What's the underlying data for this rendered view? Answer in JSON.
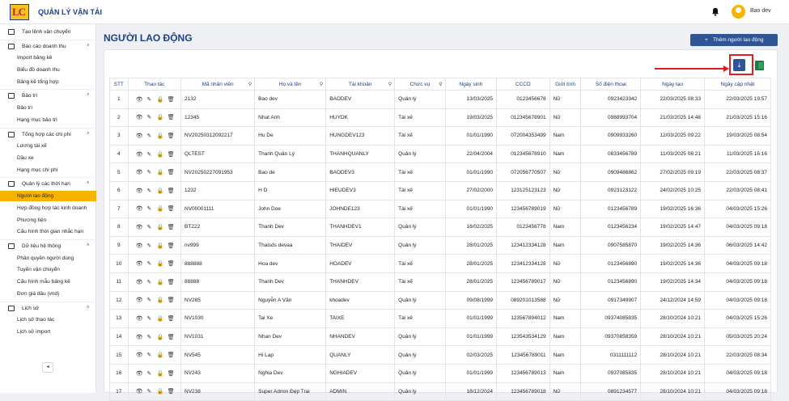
{
  "app": {
    "name": "QUẢN LÝ VẬN TẢI",
    "logo_text": "LC",
    "user": "Bao dev"
  },
  "sidebar": {
    "items": [
      {
        "type": "group",
        "label": "Tạo lệnh vận chuyển",
        "icon": "truck-icon",
        "chev": ""
      },
      {
        "type": "group",
        "label": "Báo cáo doanh thu",
        "icon": "report-icon",
        "chev": "˄"
      },
      {
        "type": "sub",
        "label": "Import bảng kê"
      },
      {
        "type": "sub",
        "label": "Biểu đồ doanh thu"
      },
      {
        "type": "sub",
        "label": "Bảng kê tổng hợp"
      },
      {
        "type": "group",
        "label": "Bảo trì",
        "icon": "wrench-icon",
        "chev": "˄"
      },
      {
        "type": "sub",
        "label": "Bảo trì"
      },
      {
        "type": "sub",
        "label": "Hạng mục bảo trì"
      },
      {
        "type": "group",
        "label": "Tổng hợp các chi phí",
        "icon": "cost-icon",
        "chev": "˄"
      },
      {
        "type": "sub",
        "label": "Lương tài xế"
      },
      {
        "type": "sub",
        "label": "Dầu xe"
      },
      {
        "type": "sub",
        "label": "Hạng mục chi phí"
      },
      {
        "type": "group",
        "label": "Quản lý các thời hạn",
        "icon": "clock-icon",
        "chev": "˄"
      },
      {
        "type": "sub",
        "label": "Người lao động",
        "active": true
      },
      {
        "type": "sub",
        "label": "Hợp đồng hợp tác kinh doanh"
      },
      {
        "type": "sub",
        "label": "Phương tiện"
      },
      {
        "type": "sub",
        "label": "Cấu hình thời gian nhắc hạn"
      },
      {
        "type": "group",
        "label": "Dữ liệu hệ thống",
        "icon": "database-icon",
        "chev": "˄"
      },
      {
        "type": "sub",
        "label": "Phân quyền người dùng"
      },
      {
        "type": "sub",
        "label": "Tuyến vận chuyển"
      },
      {
        "type": "sub",
        "label": "Cấu hình mẫu bảng kê"
      },
      {
        "type": "sub",
        "label": "Đơn giá dầu (vnd)"
      },
      {
        "type": "group",
        "label": "Lịch sử",
        "icon": "history-icon",
        "chev": "˄"
      },
      {
        "type": "sub",
        "label": "Lịch sử thao tác"
      },
      {
        "type": "sub",
        "label": "Lịch sử import"
      }
    ],
    "collapse_glyph": "◂"
  },
  "page": {
    "title": "NGƯỜI LAO ĐỘNG",
    "add_button": "Thêm người lao động",
    "add_glyph": "+",
    "download_glyph": "⤓"
  },
  "table": {
    "columns": [
      "STT",
      "Thao tác",
      "Mã nhân viên",
      "Họ và tên",
      "Tài khoản",
      "Chức vụ",
      "Ngày sinh",
      "CCCD",
      "Giới tính",
      "Số điện thoại",
      "Ngày tạo",
      "Ngày cập nhật"
    ],
    "searchable": [
      false,
      false,
      true,
      true,
      true,
      true,
      false,
      false,
      false,
      false,
      false,
      false
    ],
    "action_glyphs": [
      "👁",
      "✎",
      "🔒",
      "🗑"
    ],
    "rows": [
      [
        "1",
        "",
        "2132",
        "Bao dev",
        "BAODEV",
        "Quản lý",
        "13/03/2025",
        "0123456678",
        "Nữ",
        "0923423342",
        "22/03/2025 08:33",
        "22/03/2025 19:57"
      ],
      [
        "2",
        "",
        "12345",
        "Nhat Anh",
        "HUYDK",
        "Tài xế",
        "19/03/2025",
        "012345678901",
        "Nữ",
        "0988993704",
        "21/03/2025 14:48",
        "21/03/2025 15:16"
      ],
      [
        "3",
        "",
        "NV20250312092217",
        "Hu De",
        "HUNGDEV123",
        "Tài xế",
        "01/01/1990",
        "072004353499",
        "Nam",
        "0909933260",
        "12/03/2025 09:22",
        "19/03/2025 08:54"
      ],
      [
        "4",
        "",
        "QLTEST",
        "Thanh Quản Lý",
        "THANHQUANLY",
        "Quản lý",
        "22/04/2004",
        "012345678910",
        "Nam",
        "0833456789",
        "11/03/2025 08:21",
        "11/03/2025 16:16"
      ],
      [
        "5",
        "",
        "NV20250227091953",
        "Bao de",
        "BAODEV3",
        "Tài xế",
        "01/01/1990",
        "072056770507",
        "Nữ",
        "0909486862",
        "27/02/2025 09:19",
        "22/03/2025 08:37"
      ],
      [
        "6",
        "",
        "1232",
        "H D",
        "HIEUDEV3",
        "Tài xế",
        "27/02/2000",
        "123125123123",
        "Nữ",
        "0923123122",
        "24/02/2025 10:25",
        "22/03/2025 08:41"
      ],
      [
        "7",
        "",
        "NV00001111",
        "John Doe",
        "JOHNDE123",
        "Tài xế",
        "01/01/1990",
        "123456789019",
        "Nữ",
        "0123456789",
        "19/02/2025 16:36",
        "04/03/2025 15:26"
      ],
      [
        "8",
        "",
        "BT222",
        "Thanh Dev",
        "THANHDEV1",
        "Quản lý",
        "18/02/2025",
        "0123456778",
        "Nam",
        "0123456234",
        "19/02/2025 14:47",
        "04/03/2025 09:18"
      ],
      [
        "9",
        "",
        "nv999",
        "Thaisds devaa",
        "THAIDEV",
        "Quản lý",
        "28/01/2025",
        "123412334128",
        "Nam",
        "0907585870",
        "19/02/2025 14:36",
        "06/03/2025 14:42"
      ],
      [
        "10",
        "",
        "888888",
        "Hoa dev",
        "HOADEV",
        "Tài xế",
        "28/01/2025",
        "123412334128",
        "Nữ",
        "0123456890",
        "19/02/2025 14:36",
        "04/03/2025 09:18"
      ],
      [
        "11",
        "",
        "88888",
        "Thanh Dev",
        "THANHDEV",
        "Tài xế",
        "28/01/2025",
        "123456789017",
        "Nữ",
        "0123456890",
        "19/02/2025 14:34",
        "04/03/2025 09:18"
      ],
      [
        "12",
        "",
        "NV285",
        "Nguyễn A Văn",
        "khoadev",
        "Quản lý",
        "09/08/1999",
        "089201013588",
        "Nữ",
        "0917349907",
        "24/12/2024 14:59",
        "04/03/2025 09:18"
      ],
      [
        "13",
        "",
        "NV1030",
        "Tai Xe",
        "TAIXE",
        "Tài xế",
        "01/01/1999",
        "123567894012",
        "Nam",
        "09374085835",
        "28/10/2024 10:21",
        "04/03/2025 15:26"
      ],
      [
        "14",
        "",
        "NV1031",
        "Nhan Dev",
        "NHANDEV",
        "Quản lý",
        "01/01/1999",
        "123543534129",
        "Nam",
        "09370858359",
        "28/10/2024 10:21",
        "05/03/2025 20:24"
      ],
      [
        "15",
        "",
        "NV545",
        "Hi Lap",
        "QUANLY",
        "Quản lý",
        "02/03/2025",
        "123456789011",
        "Nam",
        "0311111112",
        "28/10/2024 10:21",
        "22/03/2025 08:34"
      ],
      [
        "16",
        "",
        "NV243",
        "Nghia Dev",
        "NGHIADEV",
        "Quản lý",
        "01/01/1999",
        "123456789013",
        "Nam",
        "0937085835",
        "28/10/2024 10:21",
        "04/03/2025 09:18"
      ],
      [
        "17",
        "",
        "NV238",
        "Super Admin Đẹp Trai",
        "ADMIN",
        "Quản lý",
        "18/12/2024",
        "123456789018",
        "Nữ",
        "0891234577",
        "28/10/2024 10:21",
        "04/03/2025 09:18"
      ]
    ]
  }
}
